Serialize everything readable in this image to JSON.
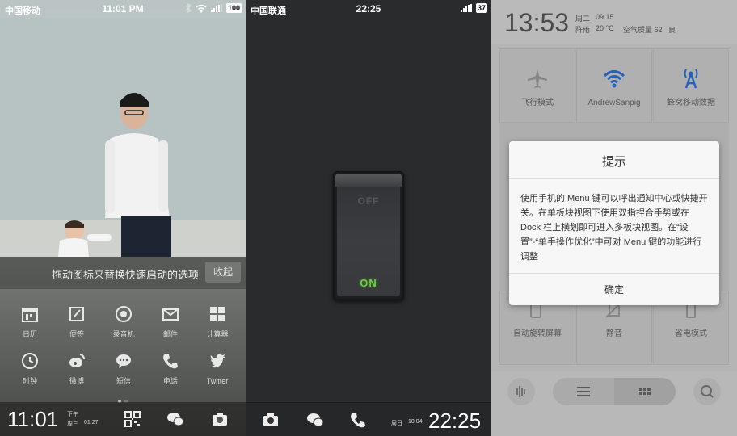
{
  "screen1": {
    "status": {
      "carrier": "中国移动",
      "time": "11:01 PM",
      "battery": "100"
    },
    "hint": "拖动图标来替换快速启动的选项",
    "collapse_label": "收起",
    "quick_items": [
      {
        "label": "日历",
        "icon": "calendar-icon"
      },
      {
        "label": "便签",
        "icon": "notes-icon"
      },
      {
        "label": "录音机",
        "icon": "recorder-icon"
      },
      {
        "label": "邮件",
        "icon": "mail-icon"
      },
      {
        "label": "计算器",
        "icon": "calculator-icon"
      },
      {
        "label": "时钟",
        "icon": "clock-icon"
      },
      {
        "label": "微博",
        "icon": "weibo-icon"
      },
      {
        "label": "短信",
        "icon": "message-icon"
      },
      {
        "label": "电话",
        "icon": "phone-icon"
      },
      {
        "label": "Twitter",
        "icon": "twitter-icon"
      }
    ],
    "dock": {
      "time": "11:01",
      "ampm": "下午",
      "weekday": "周三",
      "date": "01.27"
    }
  },
  "screen2": {
    "status": {
      "carrier": "中国联通",
      "time": "22:25",
      "battery": "37"
    },
    "switch": {
      "off_label": "OFF",
      "on_label": "ON"
    },
    "dock": {
      "time": "22:25",
      "weekday": "周日",
      "date": "10.04"
    }
  },
  "screen3": {
    "header": {
      "time": "13:53",
      "weekday": "周二",
      "date": "09.15",
      "weather": "阵雨",
      "temp": "20 °C",
      "aqi_label": "空气质量 62",
      "aqi_level": "良"
    },
    "tiles": [
      {
        "label": "飞行模式",
        "icon": "airplane-icon"
      },
      {
        "label": "AndrewSanpig",
        "icon": "wifi-icon"
      },
      {
        "label": "蜂窝移动数据",
        "icon": "cellular-icon"
      },
      {
        "label": "自动旋转屏幕",
        "icon": "rotate-icon"
      },
      {
        "label": "静音",
        "icon": "mute-icon"
      },
      {
        "label": "省电模式",
        "icon": "battery-saver-icon"
      }
    ],
    "dialog": {
      "title": "提示",
      "body": "使用手机的 Menu 键可以呼出通知中心或快捷开关。在单板块视图下使用双指捏合手势或在 Dock 栏上横划即可进入多板块视图。在“设置”-“单手操作优化”中可对 Menu 键的功能进行调整",
      "confirm": "确定"
    },
    "colors": {
      "accent_blue": "#2a6fd6"
    }
  }
}
